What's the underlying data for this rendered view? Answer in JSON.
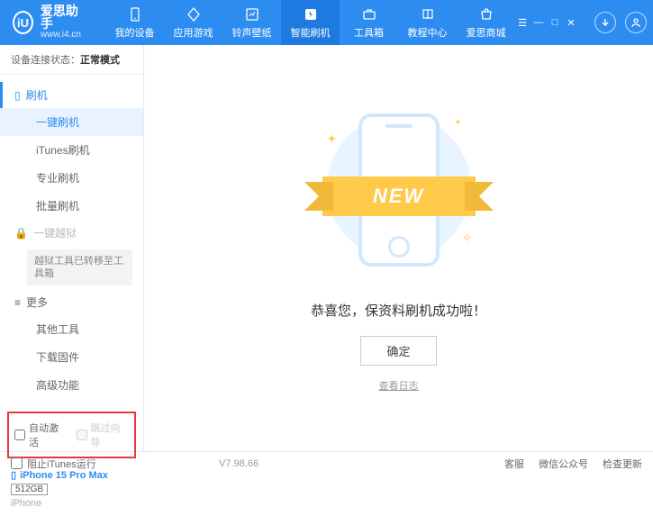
{
  "app": {
    "title": "爱思助手",
    "url": "www.i4.cn"
  },
  "nav": {
    "items": [
      {
        "label": "我的设备"
      },
      {
        "label": "应用游戏"
      },
      {
        "label": "铃声壁纸"
      },
      {
        "label": "智能刷机"
      },
      {
        "label": "工具箱"
      },
      {
        "label": "教程中心"
      },
      {
        "label": "爱思商城"
      }
    ]
  },
  "status": {
    "label": "设备连接状态：",
    "mode": "正常模式"
  },
  "sidebar": {
    "flash_head": "刷机",
    "flash_items": [
      "一键刷机",
      "iTunes刷机",
      "专业刷机",
      "批量刷机"
    ],
    "jailbreak_head": "一键越狱",
    "jailbreak_note": "越狱工具已转移至工具箱",
    "more_head": "更多",
    "more_items": [
      "其他工具",
      "下载固件",
      "高级功能"
    ]
  },
  "checkboxes": {
    "auto_activate": "自动激活",
    "skip_guide": "跳过向导"
  },
  "device": {
    "name": "iPhone 15 Pro Max",
    "storage": "512GB",
    "type": "iPhone"
  },
  "main": {
    "ribbon": "NEW",
    "success": "恭喜您，保资料刷机成功啦！",
    "ok": "确定",
    "view_log": "查看日志"
  },
  "footer": {
    "block_itunes": "阻止iTunes运行",
    "version": "V7.98.66",
    "links": [
      "客服",
      "微信公众号",
      "检查更新"
    ]
  }
}
